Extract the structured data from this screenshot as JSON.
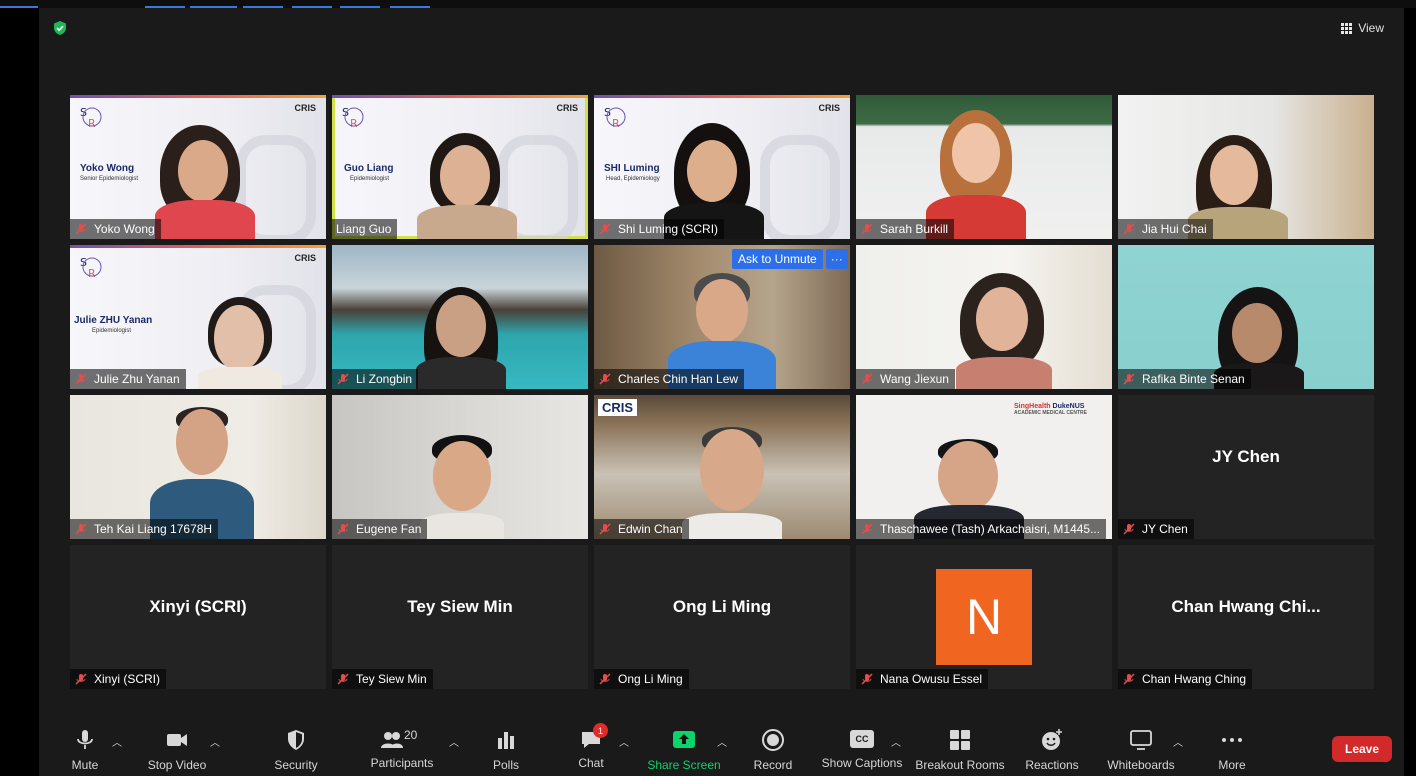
{
  "header": {
    "view_label": "View"
  },
  "tiles": [
    {
      "name": "Yoko Wong",
      "kind": "video",
      "slide_name": "Yoko Wong",
      "slide_title": "Senior Epidemiologist",
      "slide_brand": "CRIS"
    },
    {
      "name": "Liang Guo",
      "kind": "video",
      "slide_name": "Guo Liang",
      "slide_title": "Epidemiologist",
      "slide_brand": "CRIS"
    },
    {
      "name": "Shi Luming (SCRI)",
      "kind": "video",
      "slide_name": "SHI Luming",
      "slide_title": "Head, Epidemiology",
      "slide_brand": "CRIS"
    },
    {
      "name": "Sarah Burkill",
      "kind": "video"
    },
    {
      "name": "Jia Hui Chai",
      "kind": "video"
    },
    {
      "name": "Julie Zhu Yanan",
      "kind": "video",
      "slide_name": "Julie ZHU Yanan",
      "slide_title": "Epidemiologist",
      "slide_brand": "CRIS"
    },
    {
      "name": "Li Zongbin",
      "kind": "video"
    },
    {
      "name": "Charles Chin Han Lew",
      "kind": "video"
    },
    {
      "name": "Wang Jiexun",
      "kind": "video"
    },
    {
      "name": "Rafika Binte Senan",
      "kind": "video"
    },
    {
      "name": "Teh Kai Liang 17678H",
      "kind": "video"
    },
    {
      "name": "Eugene Fan",
      "kind": "video"
    },
    {
      "name": "Edwin Chan",
      "kind": "video",
      "slide_brand": "CRIS"
    },
    {
      "name": "Thaschawee (Tash) Arkachaisri, M1445...",
      "kind": "video"
    },
    {
      "name": "JY Chen",
      "kind": "text",
      "display": "JY Chen"
    },
    {
      "name": "Xinyi (SCRI)",
      "kind": "text",
      "display": "Xinyi (SCRI)"
    },
    {
      "name": "Tey Siew Min",
      "kind": "text",
      "display": "Tey Siew Min"
    },
    {
      "name": "Ong Li Ming",
      "kind": "text",
      "display": "Ong Li Ming"
    },
    {
      "name": "Nana Owusu Essel",
      "kind": "avatar",
      "initial": "N"
    },
    {
      "name": "Chan Hwang Ching",
      "kind": "text",
      "display": "Chan Hwang Chi..."
    }
  ],
  "ask_unmute": {
    "label": "Ask to Unmute",
    "more": "···"
  },
  "edwin_logo": "CRIS",
  "thasch_logo": {
    "a": "SingHealth",
    "b": "DukeNUS",
    "c": "ACADEMIC MEDICAL CENTRE"
  },
  "toolbar": {
    "mute": "Mute",
    "stop_video": "Stop Video",
    "security": "Security",
    "participants": "Participants",
    "participants_count": "20",
    "polls": "Polls",
    "chat": "Chat",
    "chat_badge": "1",
    "share_screen": "Share Screen",
    "record": "Record",
    "show_captions": "Show Captions",
    "cc": "CC",
    "breakout_rooms": "Breakout Rooms",
    "reactions": "Reactions",
    "whiteboards": "Whiteboards",
    "more": "More",
    "leave": "Leave"
  },
  "colors": {
    "accent_green": "#1db954",
    "share_green": "#0bd46a",
    "leave_red": "#d22a2a",
    "active_border": "#cfe24a",
    "avatar_orange": "#f0651f"
  }
}
